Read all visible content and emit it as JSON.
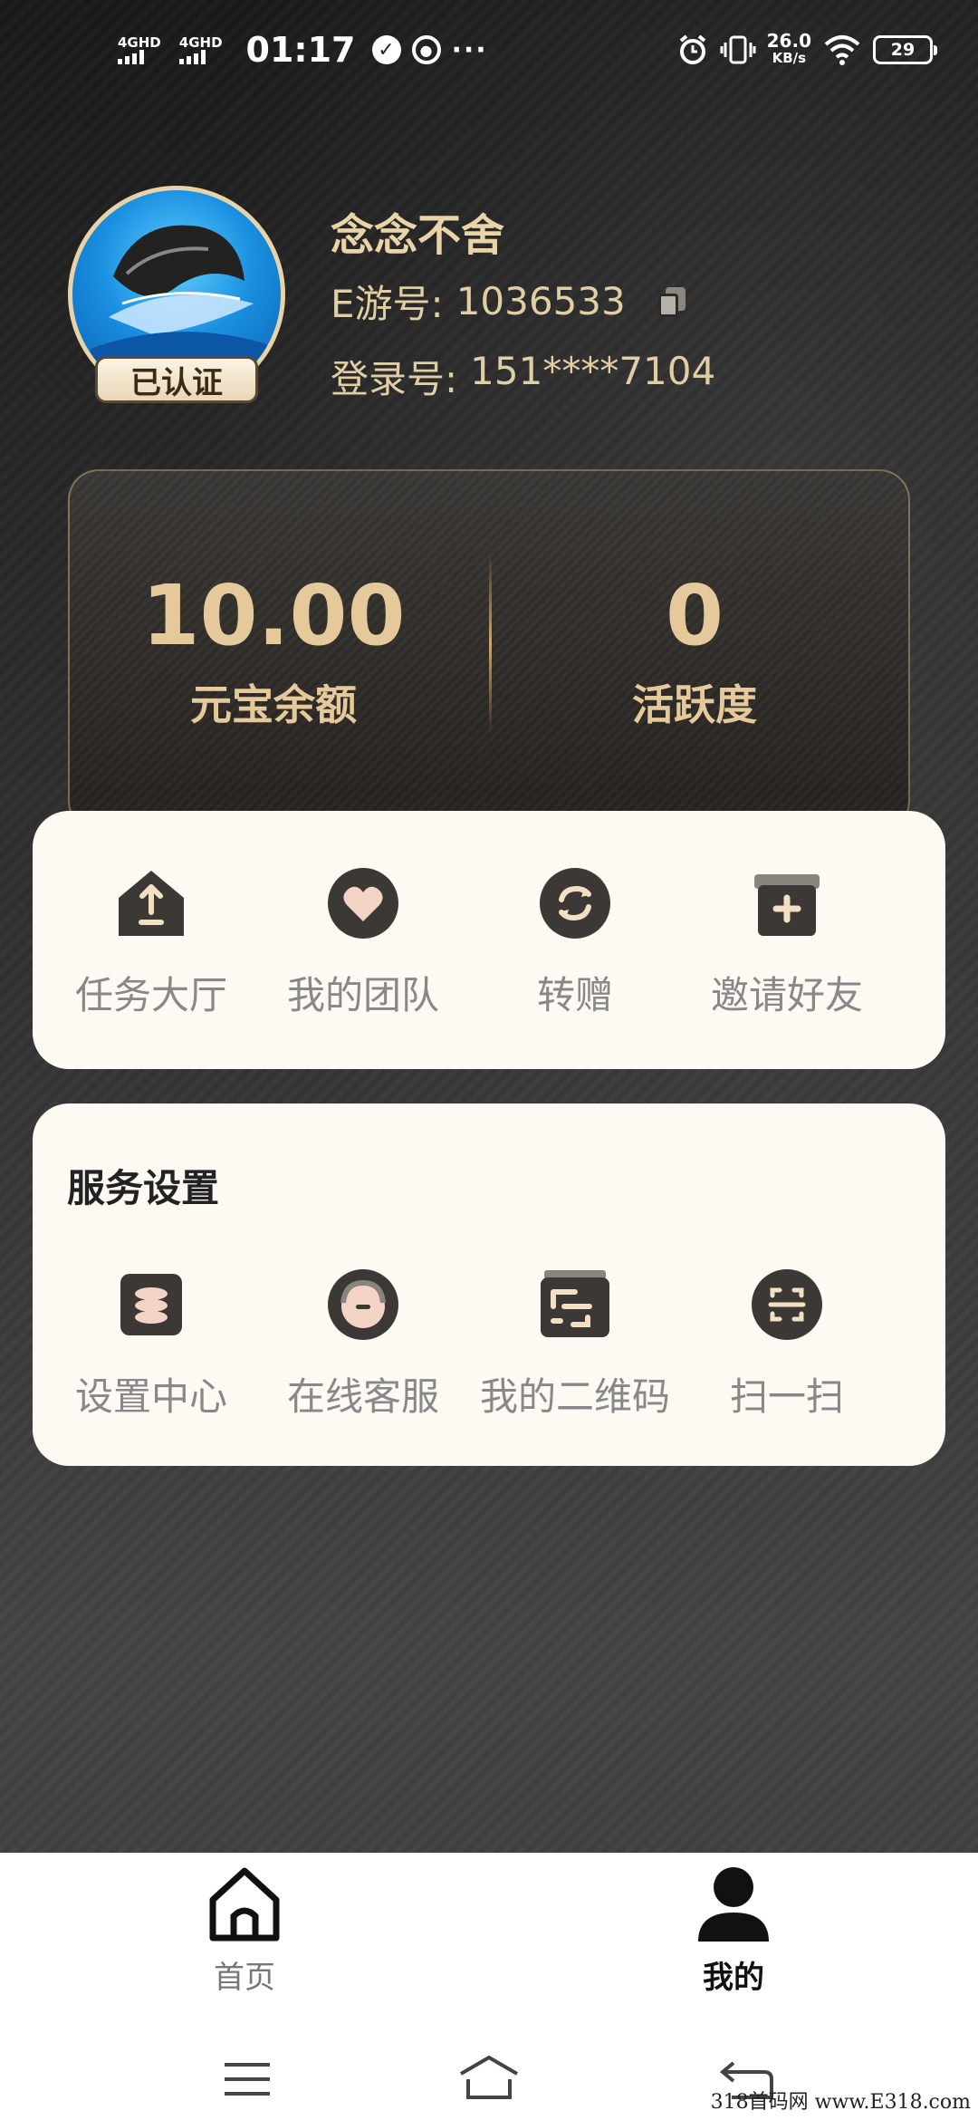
{
  "status_bar": {
    "sig1": "4GHD",
    "sig2": "4GHD",
    "time": "01:17",
    "dots": "···",
    "speed_value": "26.0",
    "speed_unit": "KB/s",
    "battery": "29"
  },
  "profile": {
    "badge": "已认证",
    "nickname": "念念不舍",
    "eid_label": "E游号:",
    "eid_value": "1036533",
    "login_label": "登录号:",
    "login_value": "151****7104"
  },
  "balance": {
    "yuanbao_value": "10.00",
    "yuanbao_label": "元宝余额",
    "activity_value": "0",
    "activity_label": "活跃度"
  },
  "quick_actions": [
    {
      "label": "任务大厅",
      "icon": "task-hall-icon"
    },
    {
      "label": "我的团队",
      "icon": "heart-icon"
    },
    {
      "label": "转赠",
      "icon": "transfer-icon"
    },
    {
      "label": "邀请好友",
      "icon": "gift-icon"
    }
  ],
  "services": {
    "title": "服务设置",
    "items": [
      {
        "label": "设置中心",
        "icon": "settings-center-icon"
      },
      {
        "label": "在线客服",
        "icon": "customer-service-icon"
      },
      {
        "label": "我的二维码",
        "icon": "qr-code-icon"
      },
      {
        "label": "扫一扫",
        "icon": "scan-icon"
      }
    ]
  },
  "tab_bar": {
    "home": "首页",
    "mine": "我的"
  },
  "watermark": "318首码网 www.E318.com",
  "colors": {
    "gold": "#e5c99a",
    "card_bg": "#fdf9f3",
    "icon_dark": "#3b3836"
  }
}
